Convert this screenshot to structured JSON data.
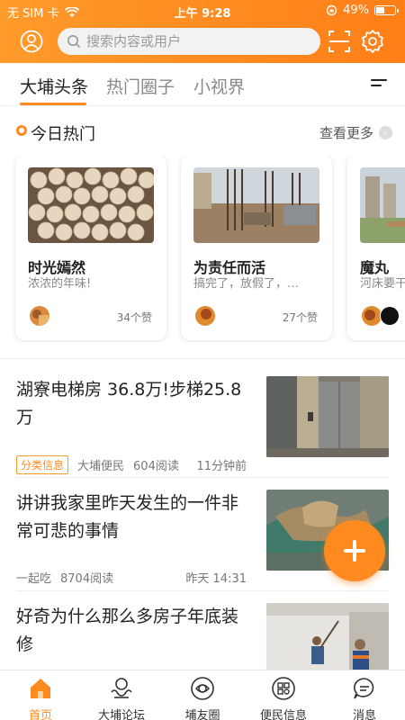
{
  "status_bar": {
    "carrier": "无 SIM 卡",
    "time": "上午 9:28",
    "battery": "49%",
    "battery_level": 0.49
  },
  "search": {
    "placeholder": "搜索内容或用户"
  },
  "icons": {
    "avatar": "user-icon",
    "scan": "scan-icon",
    "settings": "gear-icon",
    "menu": "menu-icon"
  },
  "tabs": [
    {
      "label": "大埔头条",
      "active": true
    },
    {
      "label": "热门圈子",
      "active": false
    },
    {
      "label": "小视界",
      "active": false
    }
  ],
  "hot_section": {
    "title": "今日热门",
    "more": "查看更多",
    "cards": [
      {
        "title": "时光嫣然",
        "subtitle": "浓浓的年味!",
        "likes": "34个赞"
      },
      {
        "title": "为责任而活",
        "subtitle": "搞完了，放假了，…",
        "likes": "27个赞"
      },
      {
        "title": "魔丸",
        "subtitle": "河床要干",
        "likes": ""
      }
    ]
  },
  "feed": [
    {
      "title": "湖寮电梯房 36.8万!步梯25.8万",
      "tag": "分类信息",
      "source": "大埔便民",
      "reads": "604阅读",
      "time": "11分钟前"
    },
    {
      "title": "讲讲我家里昨天发生的一件非常可悲的事情",
      "tag": "",
      "source": "一起吃",
      "reads": "8704阅读",
      "time": "昨天 14:31"
    },
    {
      "title": "好奇为什么那么多房子年底装修",
      "tag": "",
      "source": "",
      "reads": "",
      "time": ""
    }
  ],
  "bottom_nav": [
    {
      "label": "首页",
      "icon": "home-icon",
      "active": true
    },
    {
      "label": "大埔论坛",
      "icon": "forum-icon",
      "active": false
    },
    {
      "label": "埔友圈",
      "icon": "circle-icon",
      "active": false
    },
    {
      "label": "便民信息",
      "icon": "apps-icon",
      "active": false
    },
    {
      "label": "消息",
      "icon": "message-icon",
      "active": false
    }
  ],
  "colors": {
    "brand": "#ff8a1f",
    "text": "#222222",
    "muted": "#888888"
  }
}
